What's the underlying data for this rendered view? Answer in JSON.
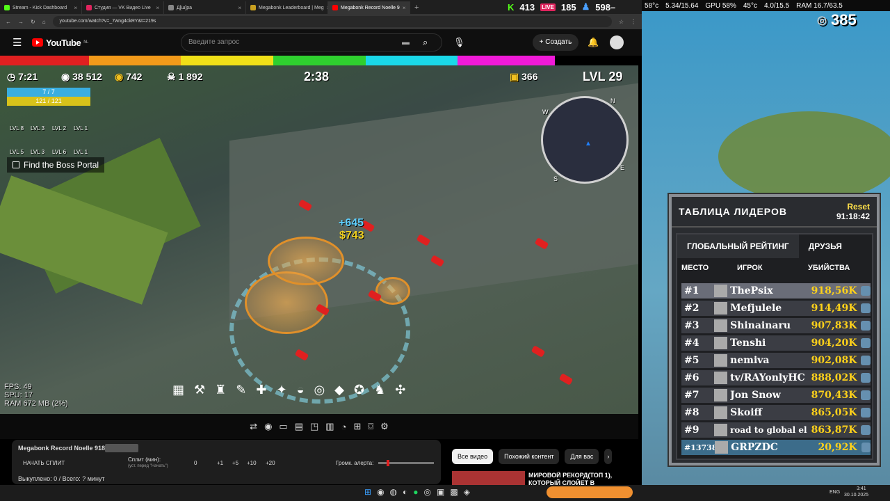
{
  "browser": {
    "tabs": [
      {
        "title": "Stream - Kick Dashboard",
        "color": "#53fc18"
      },
      {
        "title": "Студия — VK Видео Live",
        "color": "#e0245e"
      },
      {
        "title": "Д[ш]ра",
        "color": "#888888"
      },
      {
        "title": "Megabonk Leaderboard | Meg",
        "color": "#c8a020"
      },
      {
        "title": "Megabonk Record Noelle 9",
        "color": "#ff0000"
      }
    ],
    "new_tab": "+",
    "url": "youtube.com/watch?v=_7wng4ckRY&t=219s"
  },
  "stream_stats": {
    "kick": "413",
    "vk": "185",
    "viewers": "598–"
  },
  "youtube": {
    "logo": "YouTube",
    "region": "NL",
    "search_placeholder": "Введите запрос",
    "create_label": "Создать"
  },
  "game": {
    "timer": "7:21",
    "silver": "38 512",
    "gold": "742",
    "kills": "1 892",
    "stage_time": "2:38",
    "chest_count": "366",
    "level": "LVL 29",
    "hp": "7 / 7",
    "xp": "121 / 121",
    "weapon_levels": [
      "LVL 8",
      "LVL 3",
      "LVL 2",
      "LVL 1"
    ],
    "tome_levels": [
      "LVL 5",
      "LVL 3",
      "LVL 6",
      "LVL 1"
    ],
    "quest": "Find the Boss Portal",
    "float_texts": [
      "+645",
      "$743"
    ],
    "perf": [
      "FPS: 49",
      "SPU: 17",
      "RAM 672 MB (2%)"
    ],
    "compass": [
      "N",
      "E",
      "S",
      "W"
    ]
  },
  "below": {
    "video_title": "Megabonk Record Noelle 918k",
    "split_btn": "НАЧАТЬ СПЛИТ",
    "split_label": "Сплит (мин):",
    "split_hint": "(уст. перед \"Начать\")",
    "split_value": "0",
    "increments": [
      "+1",
      "+5",
      "+10",
      "+20"
    ],
    "alert_label": "Громк. алерта:",
    "done_text": "Выкуплено: 0 / Всего: ? минут",
    "rec_title": "МИРОВОЙ РЕКОРД(ТОП 1), КОТОРЫЙ СЛОЙЕТ В"
  },
  "chips": [
    "Все видео",
    "Похожий контент",
    "Для вас"
  ],
  "system": {
    "cpu_temp": "58°с",
    "freq": "5.34/15.64",
    "gpu": "GPU 58%",
    "gpu_temp": "45°с",
    "vram": "4.0/15.5",
    "ram": "RAM 16.7/63.5"
  },
  "coins": "385",
  "leaderboard": {
    "title": "ТАБЛИЦА ЛИДЕРОВ",
    "reset_label": "Reset",
    "reset_time": "91:18:42",
    "tabs": [
      "ГЛОБАЛЬНЫЙ РЕЙТИНГ",
      "ДРУЗЬЯ"
    ],
    "columns": [
      "МЕСТО",
      "ИГРОК",
      "УБИЙСТВА"
    ],
    "rows": [
      {
        "rank": "#1",
        "name": "ThePsix",
        "kills": "918,56K"
      },
      {
        "rank": "#2",
        "name": "Mefjulele",
        "kills": "914,49K"
      },
      {
        "rank": "#3",
        "name": "Shinainaru",
        "kills": "907,83K"
      },
      {
        "rank": "#4",
        "name": "Tenshi",
        "kills": "904,20K"
      },
      {
        "rank": "#5",
        "name": "nemiva",
        "kills": "902,08K"
      },
      {
        "rank": "#6",
        "name": "tv/RAYonlyHC",
        "kills": "888,02K"
      },
      {
        "rank": "#7",
        "name": "Jon Snow",
        "kills": "870,43K"
      },
      {
        "rank": "#8",
        "name": "Skoiff",
        "kills": "865,05K"
      },
      {
        "rank": "#9",
        "name": "road to global el",
        "kills": "863,87K"
      },
      {
        "rank": "#137381",
        "name": "GRPZDC",
        "kills": "20,92K"
      }
    ]
  },
  "taskbar": {
    "lang": "ENG",
    "time": "3:41",
    "date": "30.10.2025"
  }
}
